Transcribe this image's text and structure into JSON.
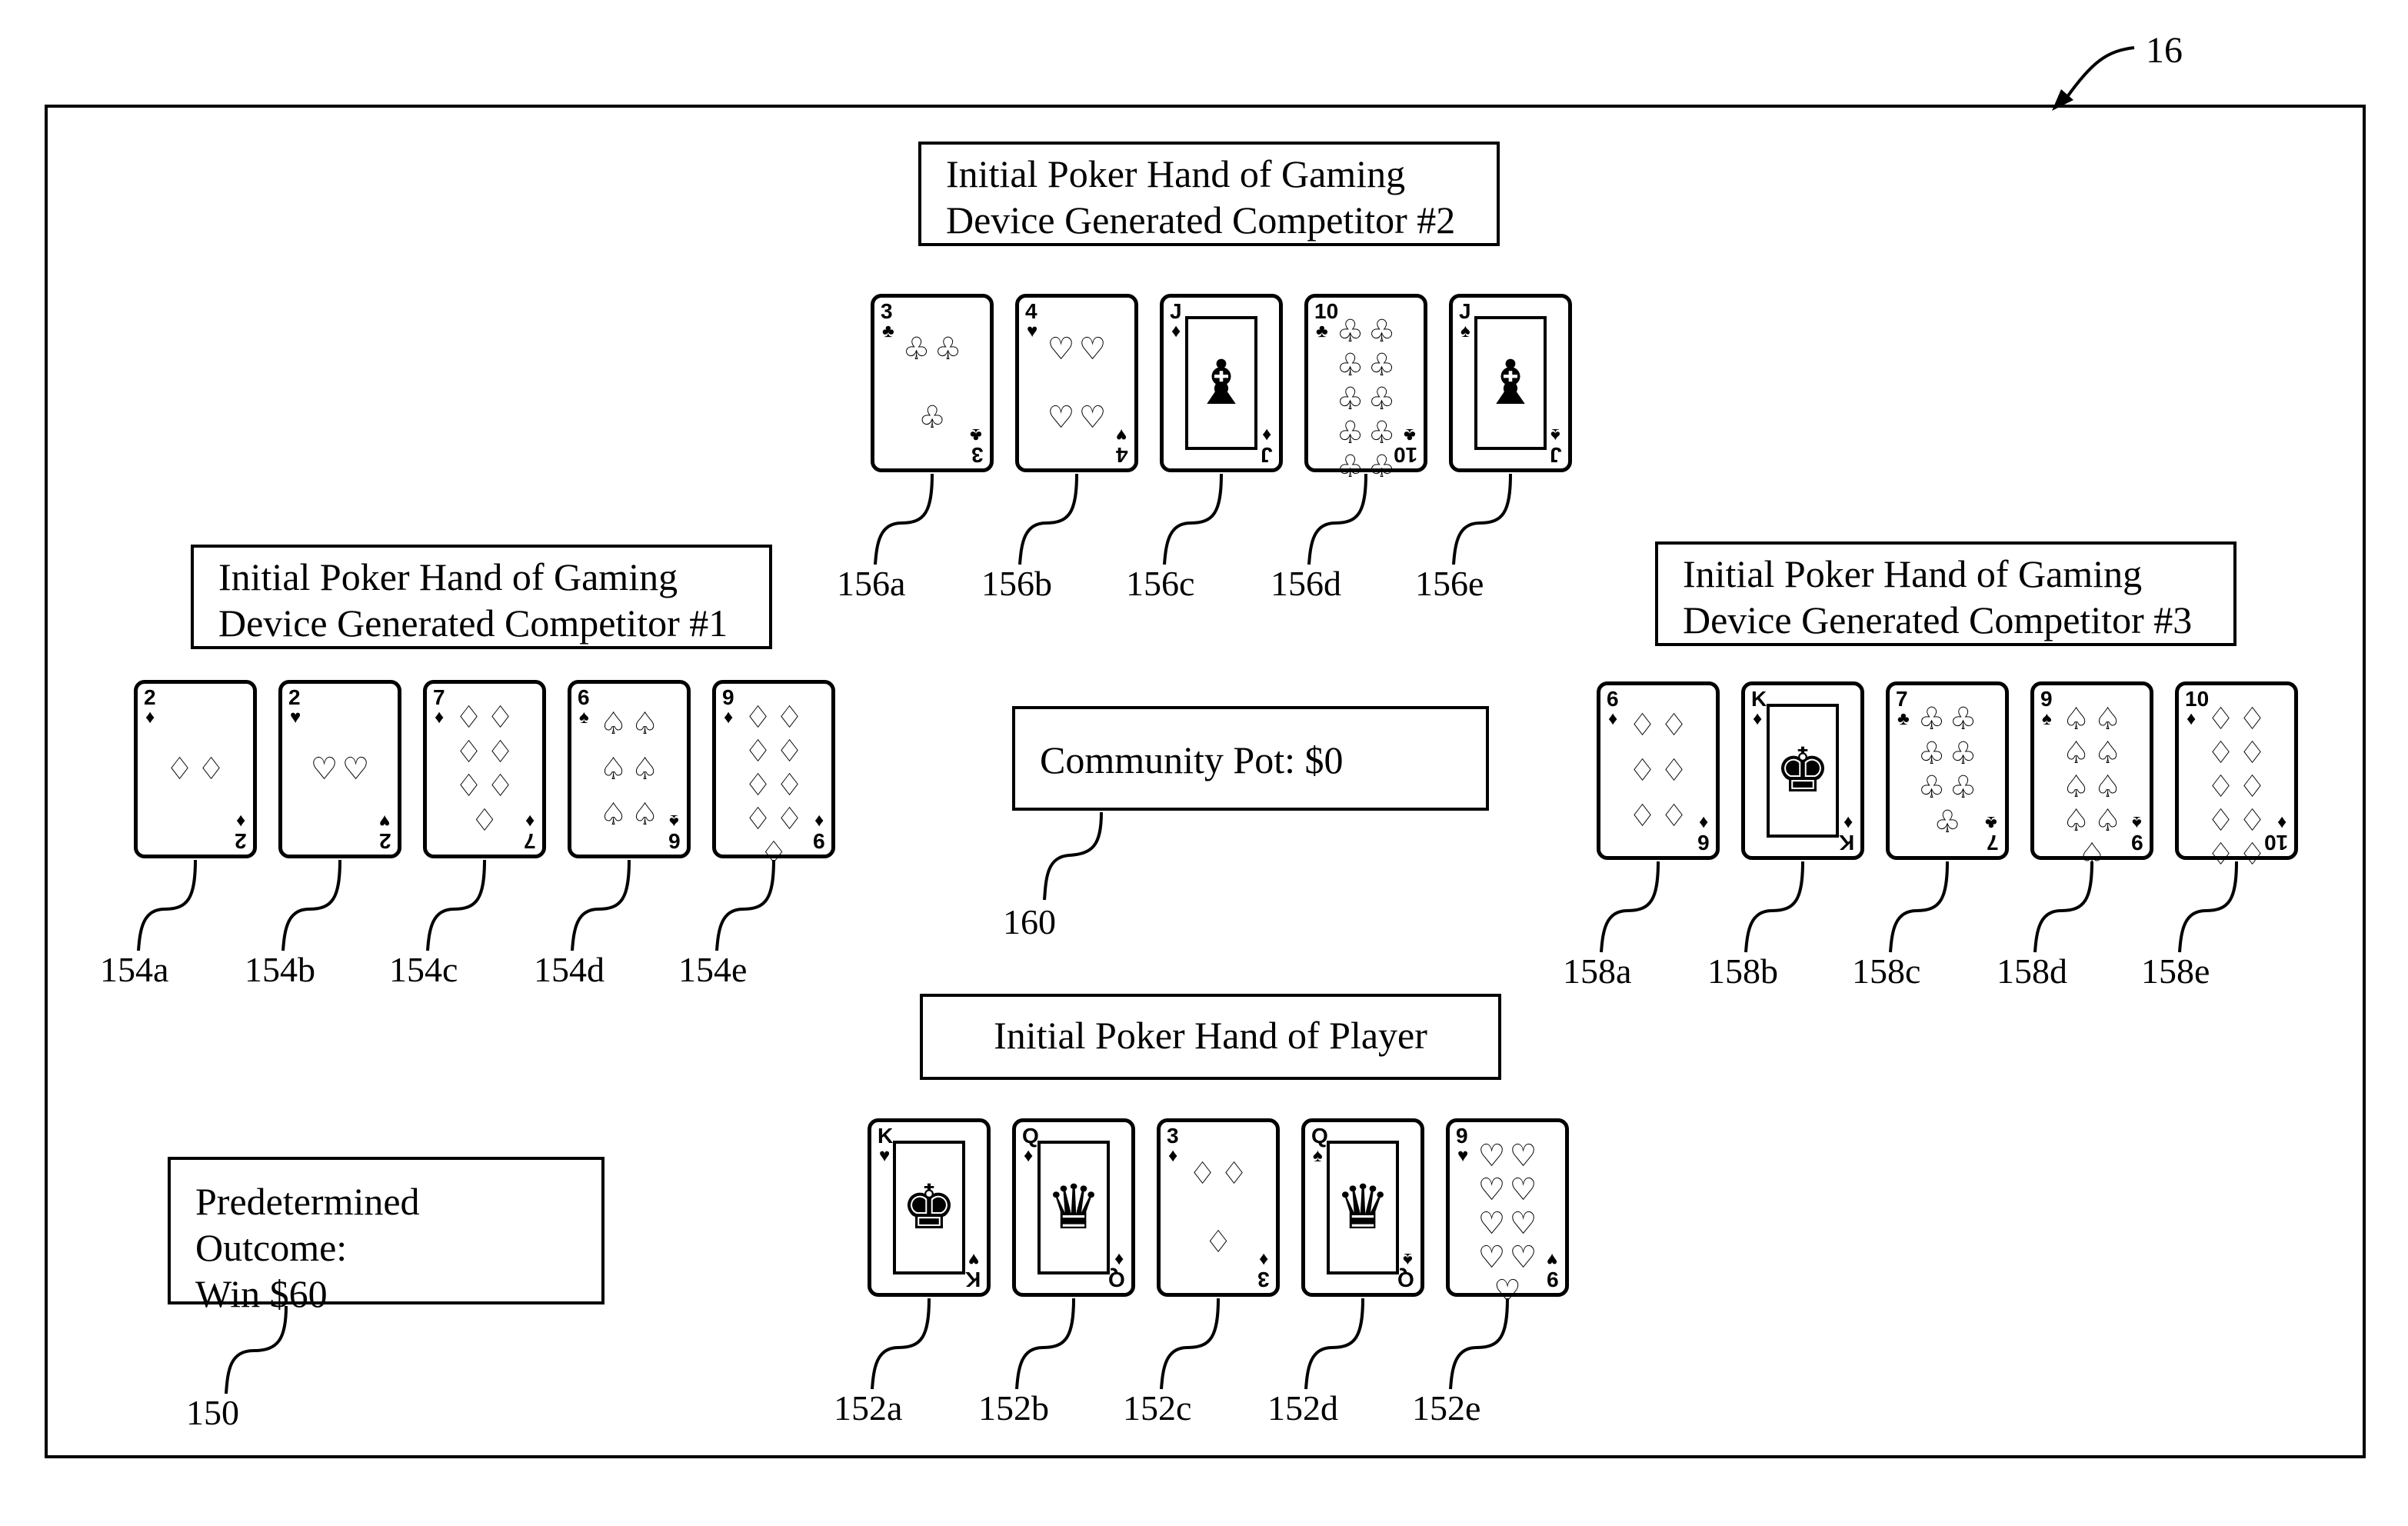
{
  "figure_ref": "16",
  "competitor2": {
    "title_line1": "Initial Poker Hand of Gaming",
    "title_line2": "Device Generated Competitor #2",
    "cards": [
      {
        "rank": "3",
        "suit": "♣",
        "ref": "156a",
        "face": false
      },
      {
        "rank": "4",
        "suit": "♥",
        "ref": "156b",
        "face": false
      },
      {
        "rank": "J",
        "suit": "♦",
        "ref": "156c",
        "face": true
      },
      {
        "rank": "10",
        "suit": "♣",
        "ref": "156d",
        "face": false
      },
      {
        "rank": "J",
        "suit": "♠",
        "ref": "156e",
        "face": true
      }
    ]
  },
  "competitor1": {
    "title_line1": "Initial Poker Hand of Gaming",
    "title_line2": "Device Generated Competitor #1",
    "cards": [
      {
        "rank": "2",
        "suit": "♦",
        "ref": "154a",
        "face": false
      },
      {
        "rank": "2",
        "suit": "♥",
        "ref": "154b",
        "face": false
      },
      {
        "rank": "7",
        "suit": "♦",
        "ref": "154c",
        "face": false
      },
      {
        "rank": "6",
        "suit": "♠",
        "ref": "154d",
        "face": false
      },
      {
        "rank": "9",
        "suit": "♦",
        "ref": "154e",
        "face": false
      }
    ]
  },
  "competitor3": {
    "title_line1": "Initial Poker Hand of Gaming",
    "title_line2": "Device Generated Competitor #3",
    "cards": [
      {
        "rank": "6",
        "suit": "♦",
        "ref": "158a",
        "face": false
      },
      {
        "rank": "K",
        "suit": "♦",
        "ref": "158b",
        "face": true
      },
      {
        "rank": "7",
        "suit": "♣",
        "ref": "158c",
        "face": false
      },
      {
        "rank": "9",
        "suit": "♠",
        "ref": "158d",
        "face": false
      },
      {
        "rank": "10",
        "suit": "♦",
        "ref": "158e",
        "face": false
      }
    ]
  },
  "player": {
    "title": "Initial Poker Hand of Player",
    "cards": [
      {
        "rank": "K",
        "suit": "♥",
        "ref": "152a",
        "face": true
      },
      {
        "rank": "Q",
        "suit": "♦",
        "ref": "152b",
        "face": true
      },
      {
        "rank": "3",
        "suit": "♦",
        "ref": "152c",
        "face": false
      },
      {
        "rank": "Q",
        "suit": "♠",
        "ref": "152d",
        "face": true
      },
      {
        "rank": "9",
        "suit": "♥",
        "ref": "152e",
        "face": false
      }
    ]
  },
  "community_pot": {
    "text": "Community Pot: $0",
    "ref": "160"
  },
  "outcome": {
    "line1": "Predetermined Outcome:",
    "line2": "Win $60",
    "ref": "150"
  }
}
